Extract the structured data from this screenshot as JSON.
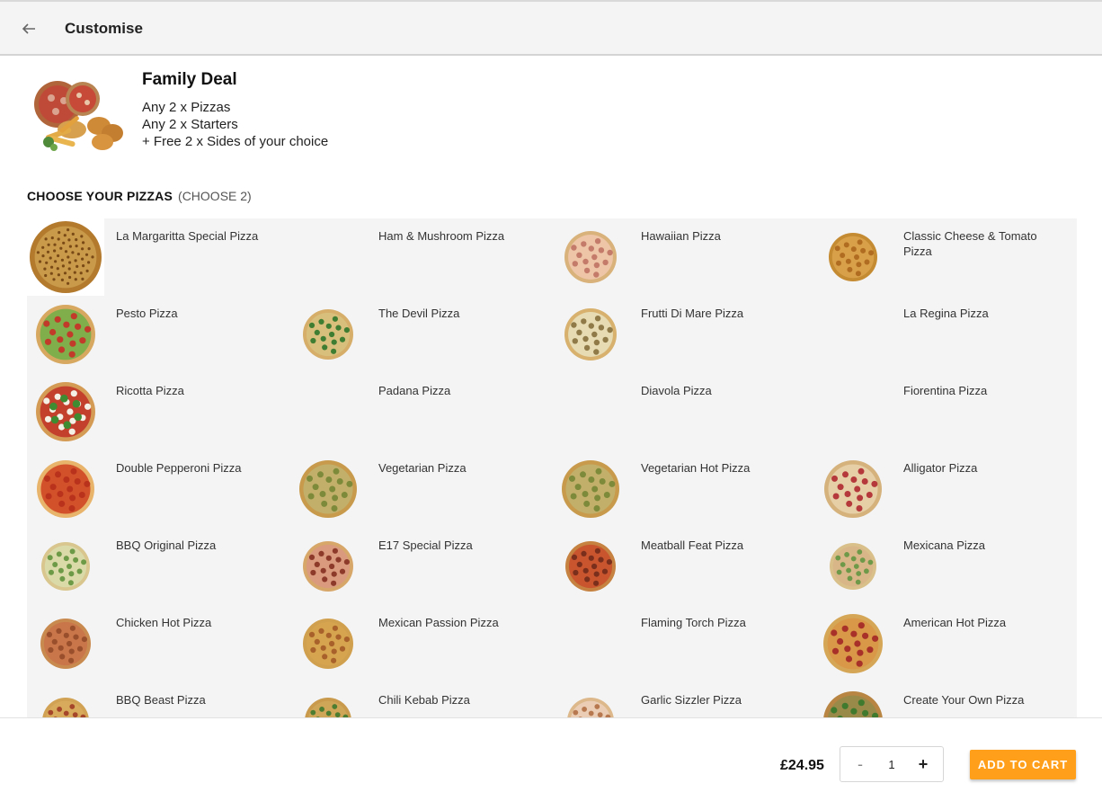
{
  "header": {
    "title": "Customise",
    "back_icon": "arrow-back-icon"
  },
  "deal": {
    "name": "Family Deal",
    "lines": [
      "Any 2 x Pizzas",
      "Any 2 x Starters",
      "+ Free 2 x Sides of your choice"
    ]
  },
  "section": {
    "title": "CHOOSE YOUR PIZZAS",
    "subtitle": "(CHOOSE 2)"
  },
  "pizzas": [
    {
      "name": "La Margaritta Special Pizza",
      "image": "margherita",
      "selected": true
    },
    {
      "name": "Ham & Mushroom Pizza",
      "image": "none"
    },
    {
      "name": "Hawaiian Pizza",
      "image": "hawaiian"
    },
    {
      "name": "Classic Cheese & Tomato Pizza",
      "image": "cheese"
    },
    {
      "name": "Pesto Pizza",
      "image": "pesto"
    },
    {
      "name": "The Devil Pizza",
      "image": "devil"
    },
    {
      "name": "Frutti Di Mare Pizza",
      "image": "seafood"
    },
    {
      "name": "La Regina Pizza",
      "image": "none"
    },
    {
      "name": "Ricotta Pizza",
      "image": "ricotta"
    },
    {
      "name": "Padana Pizza",
      "image": "none"
    },
    {
      "name": "Diavola Pizza",
      "image": "none"
    },
    {
      "name": "Fiorentina Pizza",
      "image": "none"
    },
    {
      "name": "Double Pepperoni Pizza",
      "image": "pepperoni"
    },
    {
      "name": "Vegetarian Pizza",
      "image": "vegetarian"
    },
    {
      "name": "Vegetarian Hot Pizza",
      "image": "vegetarian"
    },
    {
      "name": "Alligator Pizza",
      "image": "alligator"
    },
    {
      "name": "BBQ Original Pizza",
      "image": "bbq"
    },
    {
      "name": "E17 Special Pizza",
      "image": "e17"
    },
    {
      "name": "Meatball Feat Pizza",
      "image": "meatball"
    },
    {
      "name": "Mexicana Pizza",
      "image": "mexicana"
    },
    {
      "name": "Chicken Hot Pizza",
      "image": "chicken"
    },
    {
      "name": "Mexican Passion Pizza",
      "image": "passion"
    },
    {
      "name": "Flaming Torch Pizza",
      "image": "none"
    },
    {
      "name": "American Hot Pizza",
      "image": "american"
    },
    {
      "name": "BBQ Beast Pizza",
      "image": "beast"
    },
    {
      "name": "Chili Kebab Pizza",
      "image": "kebab"
    },
    {
      "name": "Garlic Sizzler Pizza",
      "image": "garlic"
    },
    {
      "name": "Create Your Own Pizza",
      "image": "create"
    }
  ],
  "footer": {
    "price": "£24.95",
    "quantity": "1",
    "minus_label": "-",
    "plus_label": "+",
    "add_to_cart_label": "ADD TO CART"
  },
  "colors": {
    "accent": "#ff9f1a",
    "grid_bg": "#f4f4f4",
    "header_bg": "#f4f4f4"
  }
}
